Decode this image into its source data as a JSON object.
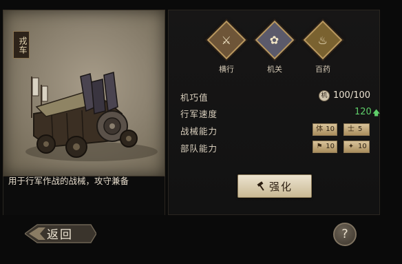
{
  "unit": {
    "tag": "戎车",
    "description": "用于行军作战的战械，攻守兼备"
  },
  "skills": [
    {
      "label": "横行",
      "icon": "crossed-swords-icon",
      "glyph": "⚔",
      "color": "#6e5538"
    },
    {
      "label": "机关",
      "icon": "paw-mechanism-icon",
      "glyph": "✿",
      "color": "#5b5a6b"
    },
    {
      "label": "百药",
      "icon": "gourd-medicine-icon",
      "glyph": "♨",
      "color": "#7a6230"
    }
  ],
  "stats": {
    "skill_value": {
      "label": "机巧值",
      "icon_char": "机",
      "value": "100/100"
    },
    "march_speed": {
      "label": "行军速度",
      "value": "120",
      "arrow": "🡅"
    },
    "weapon_ability": {
      "label": "战械能力",
      "badges": [
        {
          "icon": "体",
          "value": "10"
        },
        {
          "icon": "士",
          "value": "5"
        }
      ]
    },
    "troop_ability": {
      "label": "部队能力",
      "badges": [
        {
          "icon": "⚑",
          "value": "10"
        },
        {
          "icon": "✦",
          "value": "10"
        }
      ]
    }
  },
  "buttons": {
    "upgrade": "强化",
    "back": "返回",
    "help": "?"
  },
  "colors": {
    "accent_gold": "#b9985f",
    "speed_green": "#5fcf6a",
    "button_bg": "#e6dcc6"
  }
}
